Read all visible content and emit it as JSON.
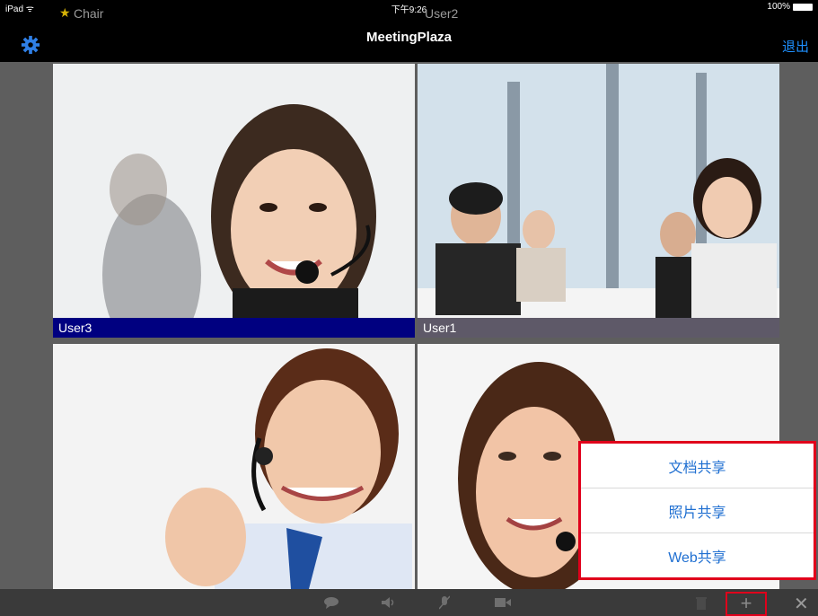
{
  "status_bar": {
    "device": "iPad",
    "time": "下午9:26",
    "battery": "100%"
  },
  "nav": {
    "title": "MeetingPlaza",
    "exit_label": "退出",
    "settings_icon": "gear-icon"
  },
  "tiles": [
    {
      "name": "User3",
      "highlight": "#000080"
    },
    {
      "name": "User1",
      "highlight": "#5e5968"
    }
  ],
  "toolbar": {
    "left_label": "Chair",
    "right_label": "User2",
    "star_icon": "star-icon",
    "chat_icon": "chat-icon",
    "speaker_icon": "speaker-icon",
    "mic_icon": "microphone-icon",
    "camera_icon": "camera-icon",
    "trash_icon": "trash-icon",
    "add_label": "+",
    "close_label": "✕"
  },
  "share_menu": {
    "items": [
      "文档共享",
      "照片共享",
      "Web共享"
    ],
    "accent": "#e0001b",
    "link_color": "#1f6fd1"
  }
}
